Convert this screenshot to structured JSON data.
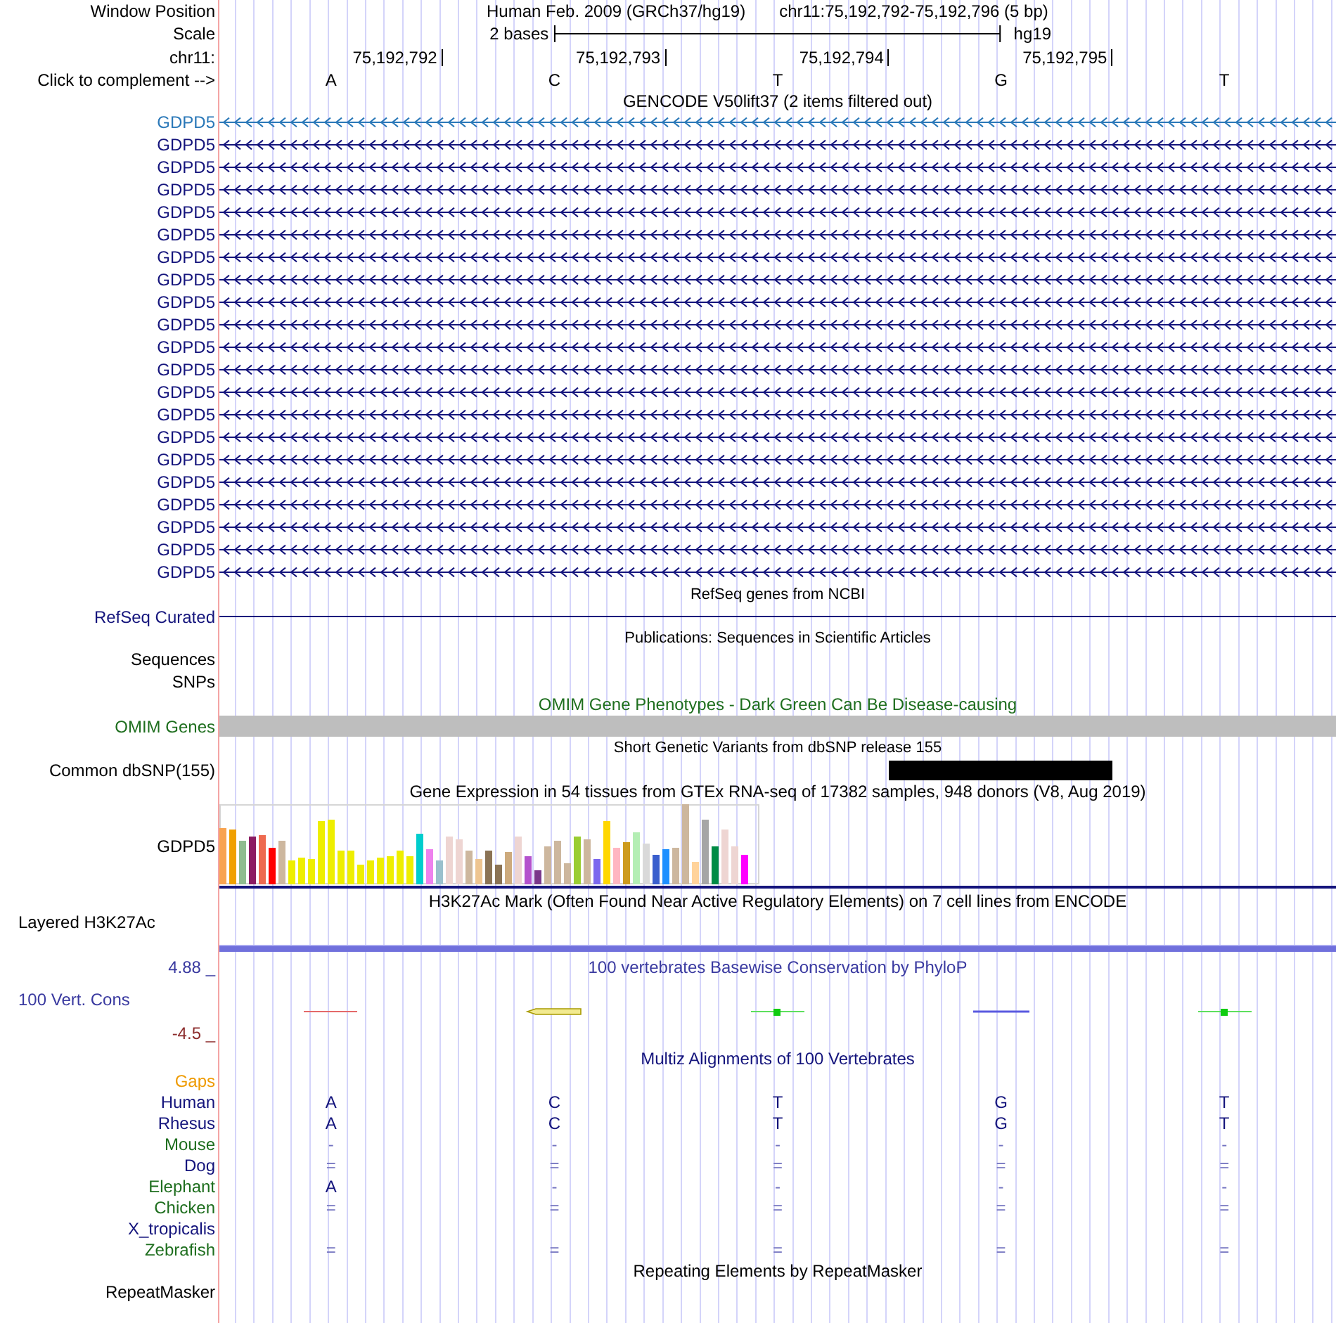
{
  "header": {
    "window_position": {
      "label": "Window Position",
      "assembly": "Human Feb. 2009 (GRCh37/hg19)",
      "position": "chr11:75,192,792-75,192,796 (5 bp)"
    },
    "scale": {
      "label": "Scale",
      "length": "2 bases",
      "assembly": "hg19"
    },
    "ruler": {
      "label": "chr11:",
      "positions": [
        "75,192,792",
        "75,192,793",
        "75,192,794",
        "75,192,795"
      ]
    },
    "complement": {
      "label": "Click to complement -->",
      "bases": [
        "A",
        "C",
        "T",
        "G",
        "T"
      ]
    }
  },
  "tracks": [
    {
      "kind": "gene_stack",
      "title": "GENCODE V50lift37 (2 items filtered out)",
      "items": [
        {
          "label": "GDPD5",
          "color": "#2a78b8"
        },
        {
          "label": "GDPD5",
          "color": "#14147c"
        },
        {
          "label": "GDPD5",
          "color": "#14147c"
        },
        {
          "label": "GDPD5",
          "color": "#14147c"
        },
        {
          "label": "GDPD5",
          "color": "#14147c"
        },
        {
          "label": "GDPD5",
          "color": "#14147c"
        },
        {
          "label": "GDPD5",
          "color": "#14147c"
        },
        {
          "label": "GDPD5",
          "color": "#14147c"
        },
        {
          "label": "GDPD5",
          "color": "#14147c"
        },
        {
          "label": "GDPD5",
          "color": "#14147c"
        },
        {
          "label": "GDPD5",
          "color": "#14147c"
        },
        {
          "label": "GDPD5",
          "color": "#14147c"
        },
        {
          "label": "GDPD5",
          "color": "#14147c"
        },
        {
          "label": "GDPD5",
          "color": "#14147c"
        },
        {
          "label": "GDPD5",
          "color": "#14147c"
        },
        {
          "label": "GDPD5",
          "color": "#14147c"
        },
        {
          "label": "GDPD5",
          "color": "#14147c"
        },
        {
          "label": "GDPD5",
          "color": "#14147c"
        },
        {
          "label": "GDPD5",
          "color": "#14147c"
        },
        {
          "label": "GDPD5",
          "color": "#14147c"
        },
        {
          "label": "GDPD5",
          "color": "#14147c"
        }
      ]
    },
    {
      "kind": "gene_line",
      "title": "RefSeq genes from NCBI",
      "label": "RefSeq Curated"
    },
    {
      "kind": "labels_only",
      "title": "Publications: Sequences in Scientific Articles",
      "labels": [
        "Sequences",
        "SNPs"
      ]
    },
    {
      "kind": "region_bar",
      "title": "OMIM Gene Phenotypes - Dark Green Can Be Disease-causing",
      "label": "OMIM Genes"
    },
    {
      "kind": "variant",
      "title": "Short Genetic Variants from dbSNP release 155",
      "label": "Common dbSNP(155)"
    },
    {
      "kind": "expression",
      "title": "Gene Expression in 54 tissues from GTEx RNA-seq of 17382 samples, 948 donors (V8, Aug 2019)",
      "label": "GDPD5"
    },
    {
      "kind": "signal",
      "title": "H3K27Ac Mark (Often Found Near Active Regulatory Elements) on 7 cell lines from ENCODE",
      "label": "Layered H3K27Ac"
    },
    {
      "kind": "conservation",
      "title": "100 vertebrates Basewise Conservation by PhyloP",
      "label": "100 Vert. Cons",
      "max": "4.88 _",
      "min": "-4.5 _"
    },
    {
      "kind": "alignment",
      "title": "Multiz Alignments of 100 Vertebrates",
      "species": [
        {
          "label": "Gaps",
          "color": "#ee9a00"
        },
        {
          "label": "Human",
          "color": "#14147c",
          "bases": [
            {
              "text": "A",
              "kind": "base"
            },
            {
              "text": "C",
              "kind": "base"
            },
            {
              "text": "T",
              "kind": "base"
            },
            {
              "text": "G",
              "kind": "base"
            },
            {
              "text": "T",
              "kind": "base"
            }
          ]
        },
        {
          "label": "Rhesus",
          "color": "#14147c",
          "bases": [
            {
              "text": "A",
              "kind": "base"
            },
            {
              "text": "C",
              "kind": "base"
            },
            {
              "text": "T",
              "kind": "base"
            },
            {
              "text": "G",
              "kind": "base"
            },
            {
              "text": "T",
              "kind": "base"
            }
          ]
        },
        {
          "label": "Mouse",
          "color": "#1e6e1e",
          "bases": [
            {
              "text": "-",
              "kind": "gap"
            },
            {
              "text": "-",
              "kind": "gap"
            },
            {
              "text": "-",
              "kind": "gap"
            },
            {
              "text": "-",
              "kind": "gap"
            },
            {
              "text": "-",
              "kind": "gap"
            }
          ]
        },
        {
          "label": "Dog",
          "color": "#14147c",
          "bases": [
            {
              "text": "=",
              "kind": "gap"
            },
            {
              "text": "=",
              "kind": "gap"
            },
            {
              "text": "=",
              "kind": "gap"
            },
            {
              "text": "=",
              "kind": "gap"
            },
            {
              "text": "=",
              "kind": "gap"
            }
          ]
        },
        {
          "label": "Elephant",
          "color": "#1e6e1e",
          "bases": [
            {
              "text": "A",
              "kind": "base"
            },
            {
              "text": "-",
              "kind": "gap"
            },
            {
              "text": "-",
              "kind": "gap"
            },
            {
              "text": "-",
              "kind": "gap"
            },
            {
              "text": "-",
              "kind": "gap"
            }
          ]
        },
        {
          "label": "Chicken",
          "color": "#1e6e1e",
          "bases": [
            {
              "text": "=",
              "kind": "gap"
            },
            {
              "text": "=",
              "kind": "gap"
            },
            {
              "text": "=",
              "kind": "gap"
            },
            {
              "text": "=",
              "kind": "gap"
            },
            {
              "text": "=",
              "kind": "gap"
            }
          ]
        },
        {
          "label": "X_tropicalis",
          "color": "#14147c"
        },
        {
          "label": "Zebrafish",
          "color": "#1e6e1e",
          "bases": [
            {
              "text": "=",
              "kind": "gap"
            },
            {
              "text": "=",
              "kind": "gap"
            },
            {
              "text": "=",
              "kind": "gap"
            },
            {
              "text": "=",
              "kind": "gap"
            },
            {
              "text": "=",
              "kind": "gap"
            }
          ]
        }
      ]
    },
    {
      "kind": "repeat",
      "title": "Repeating Elements by RepeatMasker",
      "label": "RepeatMasker"
    }
  ]
}
